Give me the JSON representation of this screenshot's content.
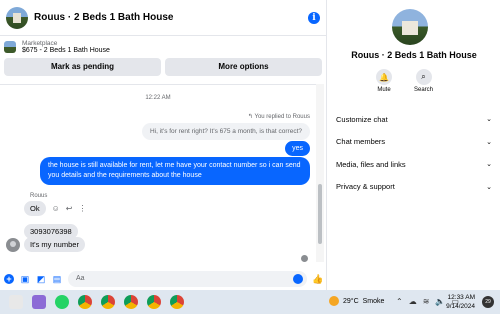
{
  "header": {
    "title": "Rouus · 2 Beds 1 Bath House"
  },
  "marketplace": {
    "label": "Marketplace",
    "listing": "$675 - 2 Beds 1 Bath House",
    "mark_pending": "Mark as pending",
    "more_options": "More options"
  },
  "messages": {
    "timestamp": "12:22 AM",
    "replied_note": "You replied to Rouus",
    "quoted": "Hi, it's for rent right? It's 675 a month, is that correct?",
    "yes": "yes",
    "long": "the house is still available for rent, let me have your contact number so i can send you details and the requirements about the house",
    "sender": "Rouus",
    "ok": "Ok",
    "phone": "3093076398",
    "my_number": "It's my number"
  },
  "composer": {
    "placeholder": "Aa"
  },
  "details": {
    "name": "Rouus · 2 Beds 1 Bath House",
    "mute": "Mute",
    "search": "Search",
    "menu": [
      "Customize chat",
      "Chat members",
      "Media, files and links",
      "Privacy & support"
    ]
  },
  "taskbar": {
    "temp": "29°C",
    "weather": "Smoke",
    "time": "12:33 AM",
    "date": "9/14/2024",
    "notifications": "29"
  },
  "colors": {
    "accent": "#0866ff",
    "bubble_in": "#e4e6eb",
    "taskbar": "#dfe7f0"
  }
}
